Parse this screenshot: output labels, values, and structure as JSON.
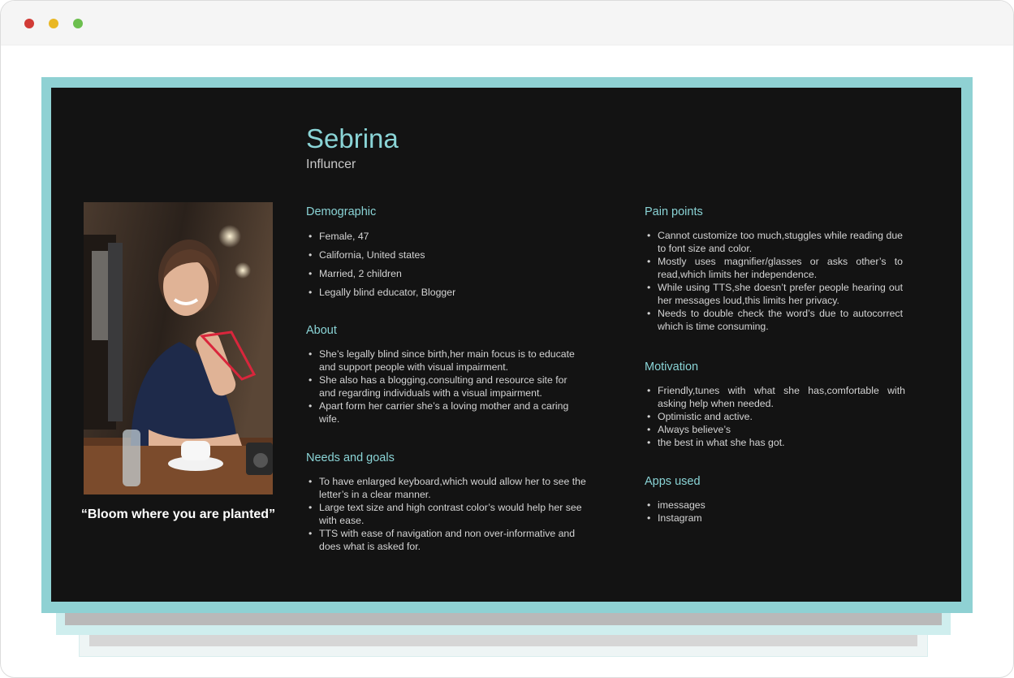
{
  "window": {
    "controls": [
      "close",
      "minimize",
      "maximize"
    ]
  },
  "persona": {
    "name": "Sebrina",
    "role": "Influncer",
    "quote": "“Bloom where you are planted”",
    "photo_icon": "portrait-photo"
  },
  "demographic": {
    "title": "Demographic",
    "items": [
      "Female, 47",
      "California, United states",
      "Married, 2 children",
      "Legally blind educator, Blogger"
    ]
  },
  "about": {
    "title": "About",
    "items": [
      "She’s legally blind since birth,her main focus is to educate and support people with visual impairment.",
      "She also has a blogging,consulting and resource site for and regarding individuals with a visual impairment.",
      "Apart form her carrier she’s a loving mother and a caring wife."
    ]
  },
  "needs": {
    "title": "Needs and goals",
    "items": [
      "To have enlarged keyboard,which would allow her to see the letter’s in a clear manner.",
      "Large text size and high contrast color’s would help her see with ease.",
      "TTS with ease of navigation and non over-informative and does what is asked for."
    ]
  },
  "pain_points": {
    "title": "Pain points",
    "items": [
      "Cannot customize too much,stuggles while reading due to font size and color.",
      "Mostly uses magnifier/glasses or asks other’s to read,which limits her independence.",
      "While using TTS,she doesn’t prefer people hearing out her messages loud,this limits her privacy.",
      "Needs to double check the word’s due to autocorrect which is time consuming."
    ]
  },
  "motivation": {
    "title": "Motivation",
    "items": [
      "Friendly,tunes with what she has,comfortable with asking help when needed.",
      "Optimistic and active.",
      "Always believe’s",
      "the best in what she has got."
    ]
  },
  "apps": {
    "title": "Apps used",
    "items": [
      "imessages",
      "Instagram"
    ]
  },
  "colors": {
    "accent": "#8ad4d6",
    "card": "#131313",
    "frame": "#8fd1d3"
  }
}
